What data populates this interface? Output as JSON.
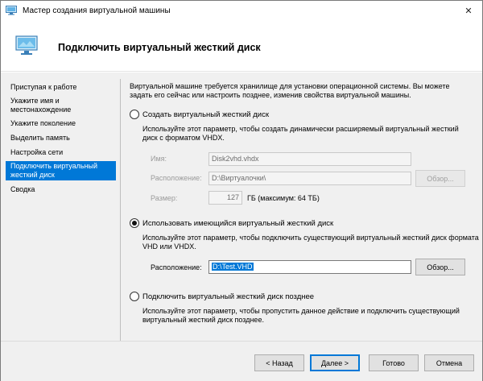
{
  "window": {
    "title": "Мастер создания виртуальной машины",
    "close_glyph": "✕"
  },
  "header": {
    "title": "Подключить виртуальный жесткий диск"
  },
  "nav": {
    "items": [
      {
        "label": "Приступая к работе"
      },
      {
        "label": "Укажите имя и местонахождение"
      },
      {
        "label": "Укажите поколение"
      },
      {
        "label": "Выделить память"
      },
      {
        "label": "Настройка сети"
      },
      {
        "label": "Подключить виртуальный жесткий диск",
        "selected": true
      },
      {
        "label": "Сводка"
      }
    ]
  },
  "content": {
    "intro": "Виртуальной машине требуется хранилище для установки операционной системы. Вы можете задать его сейчас или настроить позднее, изменив свойства виртуальной машины.",
    "option_create": {
      "label": "Создать виртуальный жесткий диск",
      "checked": false,
      "description": "Используйте этот параметр, чтобы создать динамически расширяемый виртуальный жесткий диск с форматом VHDX.",
      "name_label": "Имя:",
      "name_value": "Disk2vhd.vhdx",
      "location_label": "Расположение:",
      "location_value": "D:\\Виртуалочки\\",
      "browse_label": "Обзор...",
      "size_label": "Размер:",
      "size_value": "127",
      "size_unit": "ГБ (максимум: 64 ТБ)"
    },
    "option_existing": {
      "label": "Использовать имеющийся виртуальный жесткий диск",
      "checked": true,
      "description": "Используйте этот параметр, чтобы подключить существующий виртуальный жесткий диск формата VHD или VHDX.",
      "location_label": "Расположение:",
      "location_value": "D:\\Test.VHD",
      "browse_label": "Обзор..."
    },
    "option_later": {
      "label": "Подключить виртуальный жесткий диск позднее",
      "checked": false,
      "description": "Используйте этот параметр, чтобы пропустить данное действие и подключить существующий виртуальный жесткий диск позднее."
    }
  },
  "footer": {
    "back_label": "< Назад",
    "next_label": "Далее >",
    "finish_label": "Готово",
    "cancel_label": "Отмена"
  },
  "colors": {
    "accent": "#0078d7",
    "panel_bg": "#f0f0f0"
  },
  "icons": {
    "title_icon": "hyperv-vm-icon",
    "header_icon": "hyperv-vm-icon",
    "close_icon": "close-icon"
  }
}
